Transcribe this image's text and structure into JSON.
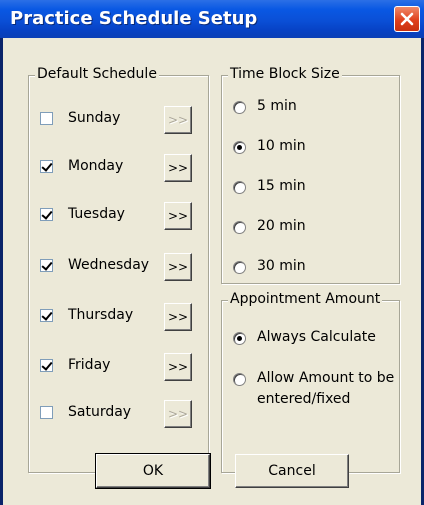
{
  "window": {
    "title": "Practice Schedule Setup"
  },
  "default_schedule": {
    "legend": "Default Schedule",
    "days": [
      {
        "label": "Sunday",
        "checked": false,
        "arrow": ">>",
        "arrow_enabled": false
      },
      {
        "label": "Monday",
        "checked": true,
        "arrow": ">>",
        "arrow_enabled": true
      },
      {
        "label": "Tuesday",
        "checked": true,
        "arrow": ">>",
        "arrow_enabled": true
      },
      {
        "label": "Wednesday",
        "checked": true,
        "arrow": ">>",
        "arrow_enabled": true
      },
      {
        "label": "Thursday",
        "checked": true,
        "arrow": ">>",
        "arrow_enabled": true
      },
      {
        "label": "Friday",
        "checked": true,
        "arrow": ">>",
        "arrow_enabled": true
      },
      {
        "label": "Saturday",
        "checked": false,
        "arrow": ">>",
        "arrow_enabled": false
      }
    ]
  },
  "time_block": {
    "legend": "Time Block Size",
    "options": [
      "5 min",
      "10 min",
      "15 min",
      "20 min",
      "30 min"
    ],
    "selected": "10 min"
  },
  "appointment_amount": {
    "legend": "Appointment Amount",
    "options": [
      "Always Calculate",
      "Allow Amount to be",
      "entered/fixed"
    ],
    "selected": "Always Calculate"
  },
  "buttons": {
    "ok": "OK",
    "cancel": "Cancel"
  }
}
